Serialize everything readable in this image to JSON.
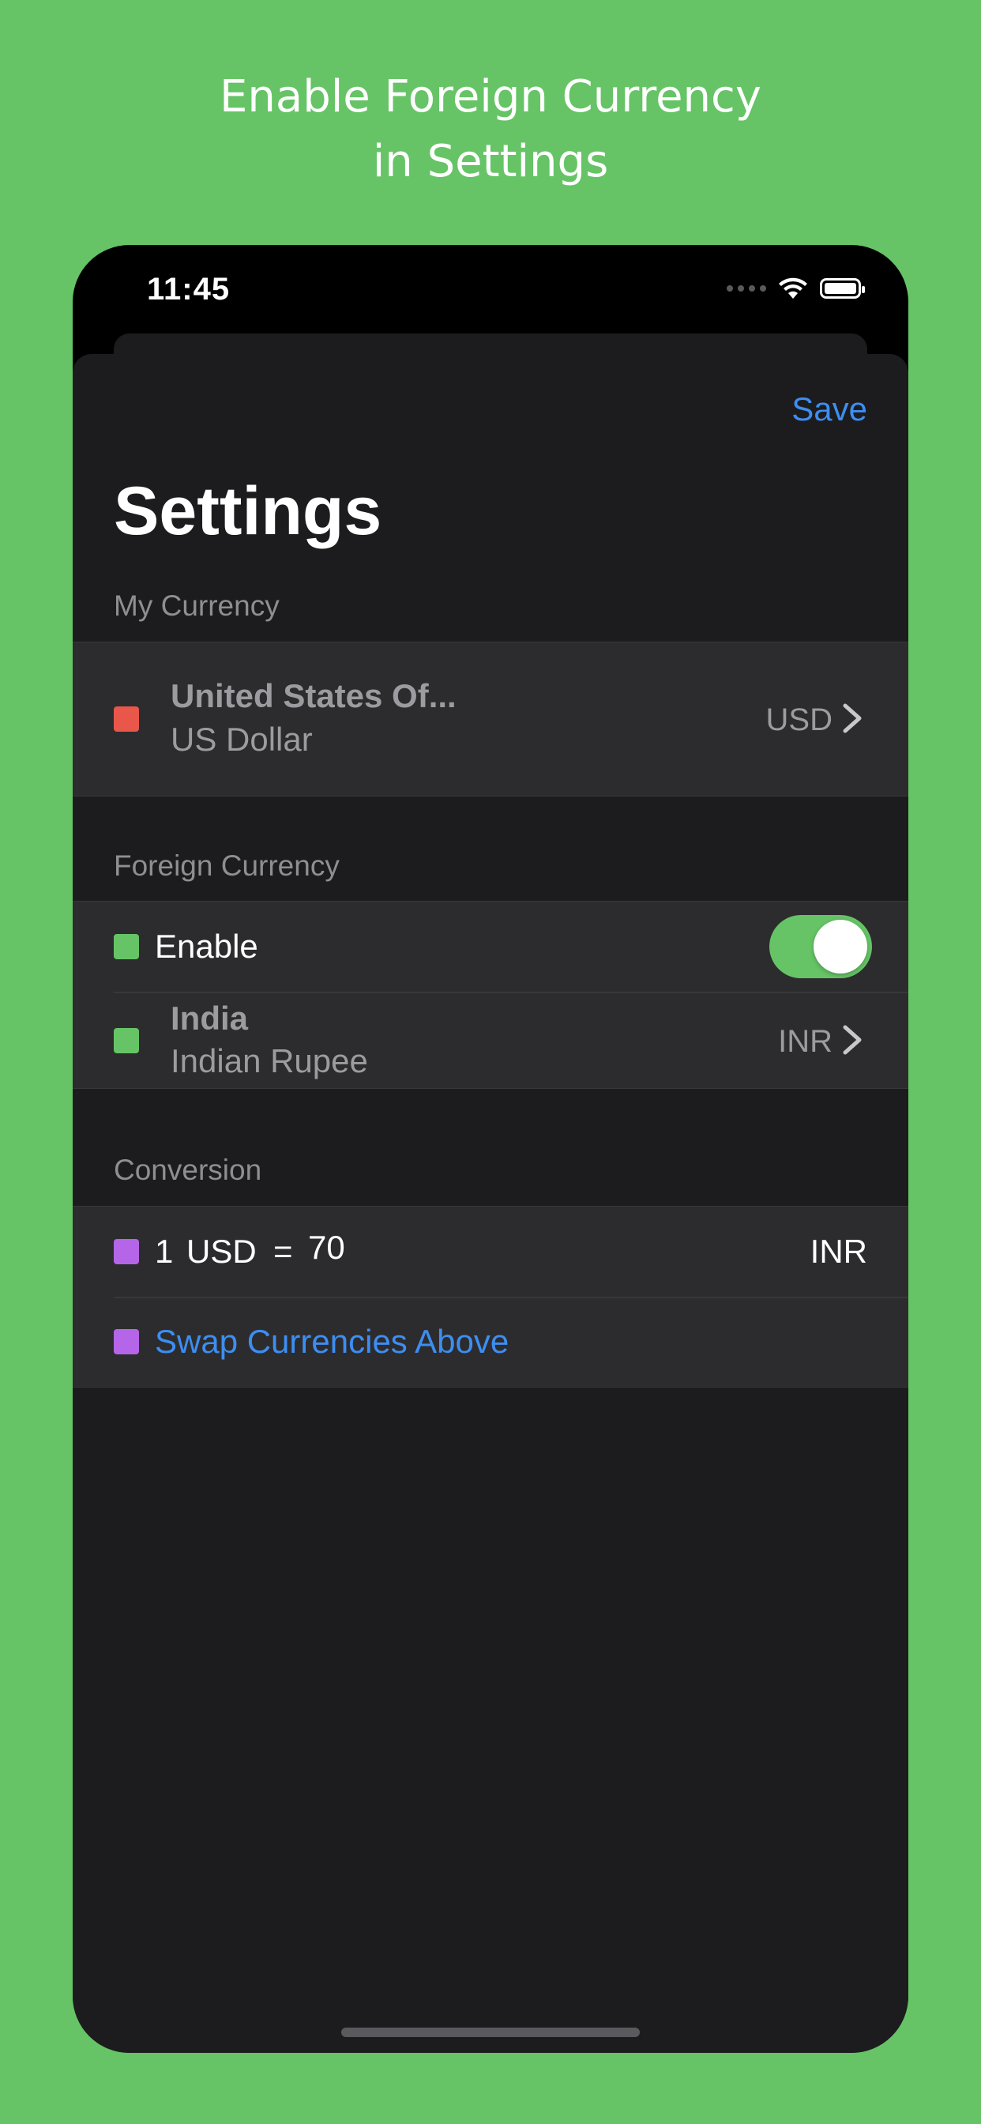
{
  "headline": {
    "line1": "Enable Foreign Currency",
    "line2": "in Settings"
  },
  "status_bar": {
    "time": "11:45"
  },
  "nav": {
    "save_label": "Save"
  },
  "page": {
    "title": "Settings"
  },
  "my_currency": {
    "section_label": "My Currency",
    "color": "#e8574a",
    "country": "United States Of...",
    "currency_name": "US Dollar",
    "code": "USD"
  },
  "foreign_currency": {
    "section_label": "Foreign Currency",
    "enable_label": "Enable",
    "enabled": true,
    "color": "#66c466",
    "country": "India",
    "currency_name": "Indian Rupee",
    "code": "INR"
  },
  "conversion": {
    "section_label": "Conversion",
    "color": "#b565e8",
    "amount": "1",
    "from_code": "USD",
    "equals": "=",
    "rate": "70",
    "to_code": "INR",
    "swap_label": "Swap Currencies Above"
  },
  "colors": {
    "background": "#66c466",
    "accent": "#3d8ef2",
    "sheet": "#1c1c1e",
    "cell": "#2c2c2e"
  }
}
